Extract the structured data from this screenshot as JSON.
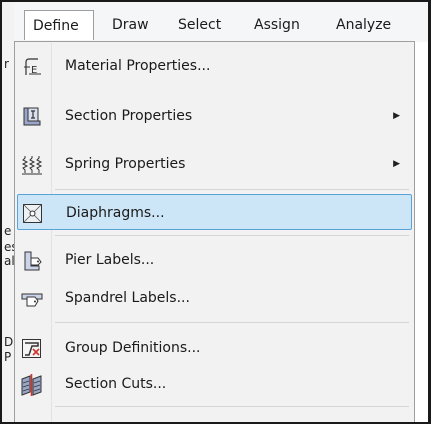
{
  "menubar": {
    "items": [
      {
        "label": "Define"
      },
      {
        "label": "Draw"
      },
      {
        "label": "Select"
      },
      {
        "label": "Assign"
      },
      {
        "label": "Analyze"
      }
    ]
  },
  "left_strip": {
    "fragments": [
      "r",
      "e",
      "es",
      "al",
      "D",
      "P"
    ]
  },
  "menu": {
    "items": [
      {
        "label": "Material Properties...",
        "icon": "material-properties-icon"
      },
      {
        "label": "Section Properties",
        "icon": "section-properties-icon",
        "submenu": true
      },
      {
        "label": "Spring Properties",
        "icon": "spring-properties-icon",
        "submenu": true
      },
      {
        "label": "Diaphragms...",
        "icon": "diaphragms-icon",
        "highlighted": true
      },
      {
        "label": "Pier Labels...",
        "icon": "pier-labels-icon"
      },
      {
        "label": "Spandrel Labels...",
        "icon": "spandrel-labels-icon"
      },
      {
        "label": "Group Definitions...",
        "icon": "group-definitions-icon"
      },
      {
        "label": "Section Cuts...",
        "icon": "section-cuts-icon"
      }
    ],
    "submenu_arrow": "▶"
  },
  "colors": {
    "highlight_fill": "#cde6f7",
    "highlight_border": "#5aa3d9",
    "menu_bg": "#f2f2f2"
  }
}
